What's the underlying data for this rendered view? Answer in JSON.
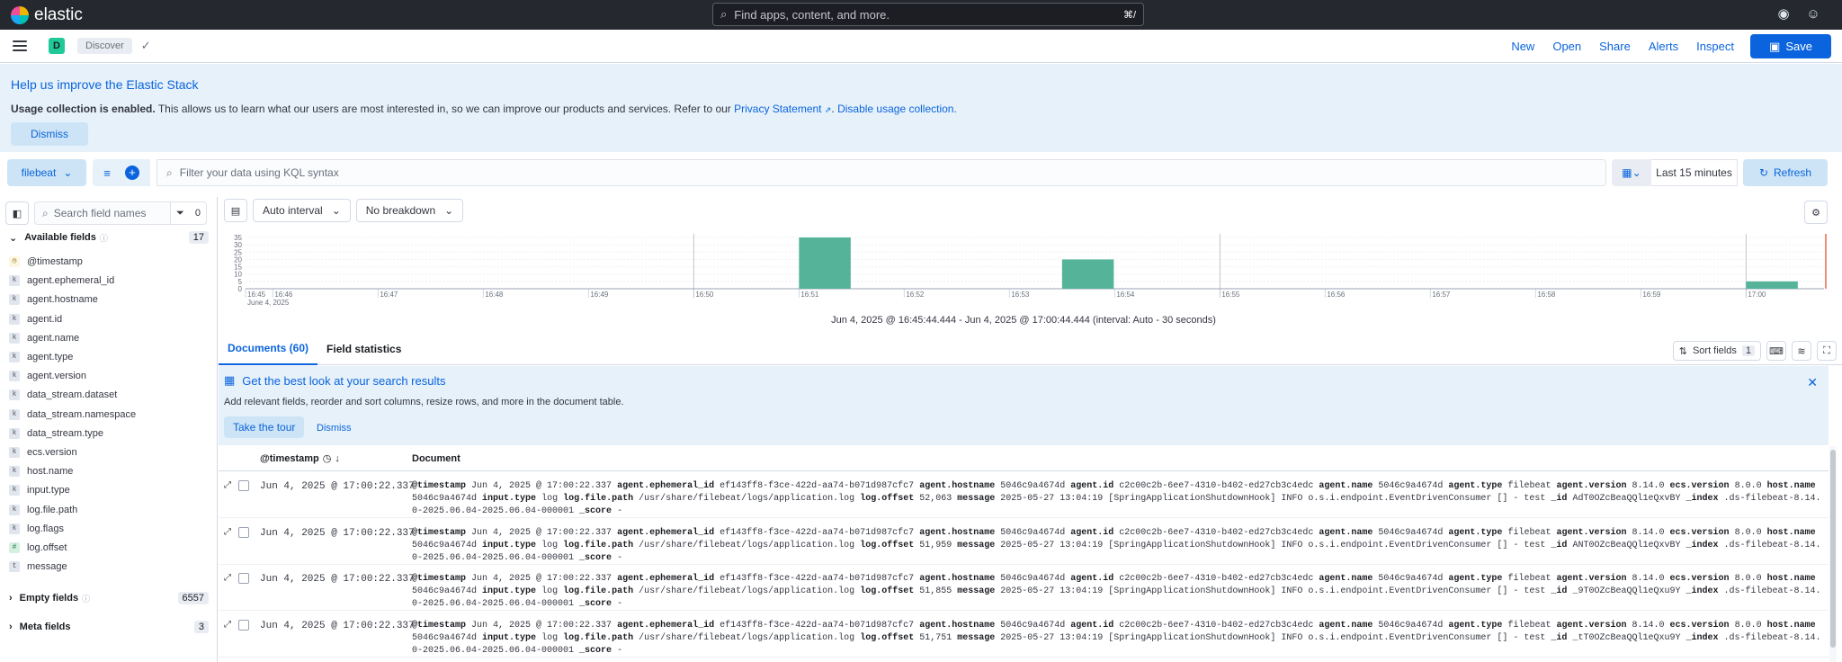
{
  "header": {
    "brand": "elastic",
    "search_placeholder": "Find apps, content, and more.",
    "search_shortcut": "⌘/",
    "icons": [
      "help-icon",
      "user-icon"
    ]
  },
  "nav": {
    "space_letter": "D",
    "breadcrumb": "Discover",
    "links": [
      "New",
      "Open",
      "Share",
      "Alerts",
      "Inspect"
    ],
    "save_label": "Save"
  },
  "callout": {
    "title": "Help us improve the Elastic Stack",
    "text_bold": "Usage collection is enabled.",
    "text": " This allows us to learn what our users are most interested in, so we can improve our products and services. Refer to our ",
    "privacy_link": "Privacy Statement",
    "disable_link": "Disable usage collection.",
    "dismiss": "Dismiss"
  },
  "query": {
    "data_view": "filebeat",
    "placeholder": "Filter your data using KQL syntax",
    "date_range": "Last 15 minutes",
    "refresh": "Refresh"
  },
  "sidebar": {
    "search_placeholder": "Search field names",
    "filter_count": "0",
    "available_label": "Available fields",
    "available_count": "17",
    "fields": [
      {
        "name": "@timestamp",
        "type": "date"
      },
      {
        "name": "agent.ephemeral_id",
        "type": "k"
      },
      {
        "name": "agent.hostname",
        "type": "k"
      },
      {
        "name": "agent.id",
        "type": "k"
      },
      {
        "name": "agent.name",
        "type": "k"
      },
      {
        "name": "agent.type",
        "type": "k"
      },
      {
        "name": "agent.version",
        "type": "k"
      },
      {
        "name": "data_stream.dataset",
        "type": "k"
      },
      {
        "name": "data_stream.namespace",
        "type": "k"
      },
      {
        "name": "data_stream.type",
        "type": "k"
      },
      {
        "name": "ecs.version",
        "type": "k"
      },
      {
        "name": "host.name",
        "type": "k"
      },
      {
        "name": "input.type",
        "type": "k"
      },
      {
        "name": "log.file.path",
        "type": "k"
      },
      {
        "name": "log.flags",
        "type": "k"
      },
      {
        "name": "log.offset",
        "type": "num"
      },
      {
        "name": "message",
        "type": "t"
      }
    ],
    "empty_label": "Empty fields",
    "empty_count": "6557",
    "meta_label": "Meta fields",
    "meta_count": "3"
  },
  "chart_tools": {
    "interval": "Auto interval",
    "breakdown": "No breakdown"
  },
  "chart_data": {
    "type": "bar",
    "y_ticks": [
      "35",
      "30",
      "25",
      "20",
      "15",
      "10",
      "5",
      "0"
    ],
    "ylim": [
      0,
      35
    ],
    "x_ticks": [
      "16:45",
      "16:46",
      "16:47",
      "16:48",
      "16:49",
      "16:50",
      "16:51",
      "16:52",
      "16:53",
      "16:54",
      "16:55",
      "16:56",
      "16:57",
      "16:58",
      "16:59",
      "17:00"
    ],
    "x_date_label": "June 4, 2025",
    "bars": [
      {
        "x": "16:51:00",
        "value": 35
      },
      {
        "x": "16:53:30",
        "value": 20
      },
      {
        "x": "17:00:00",
        "value": 5
      }
    ],
    "caption": "Jun 4, 2025 @ 16:45:44.444 - Jun 4, 2025 @ 17:00:44.444 (interval: Auto - 30 seconds)",
    "bar_color": "#54b399"
  },
  "tabs": {
    "documents": "Documents (60)",
    "field_stats": "Field statistics",
    "sort_label": "Sort fields",
    "sort_count": "1"
  },
  "tip": {
    "title": "Get the best look at your search results",
    "text": "Add relevant fields, reorder and sort columns, resize rows, and more in the document table.",
    "tour": "Take the tour",
    "dismiss": "Dismiss"
  },
  "grid": {
    "col_timestamp": "@timestamp",
    "col_document": "Document",
    "rows": [
      {
        "ts": "Jun 4, 2025 @ 17:00:22.337",
        "offset": "52,063",
        "id": "AdT0OZcBeaQQl1eQxvBY"
      },
      {
        "ts": "Jun 4, 2025 @ 17:00:22.337",
        "offset": "51,959",
        "id": "ANT0OZcBeaQQl1eQxvBY"
      },
      {
        "ts": "Jun 4, 2025 @ 17:00:22.337",
        "offset": "51,855",
        "id": "_9T0OZcBeaQQl1eQxu9Y"
      },
      {
        "ts": "Jun 4, 2025 @ 17:00:22.337",
        "offset": "51,751",
        "id": "_tT0OZcBeaQQl1eQxu9Y"
      }
    ],
    "doc": {
      "timestamp": "Jun 4, 2025 @ 17:00:22.337",
      "ephemeral_id": "ef143ff8-f3ce-422d-aa74-b071d987cfc7",
      "hostname": "5046c9a4674d",
      "agent_id": "c2c00c2b-6ee7-4310-b402-ed27cb3c4edc",
      "agent_name": "5046c9a4674d",
      "agent_type": "filebeat",
      "agent_version": "8.14.0",
      "ecs_version": "8.0.0",
      "host_name": "5046c9a4674d",
      "input_type": "log",
      "file_path": "/usr/share/filebeat/logs/application.log",
      "message": "2025-05-27 13:04:19 [SpringApplicationShutdownHook] INFO o.s.i.endpoint.EventDrivenConsumer [] - test",
      "index": ".ds-filebeat-8.14.0-2025.06.04-2025.06.04-000001",
      "score": "-"
    }
  }
}
